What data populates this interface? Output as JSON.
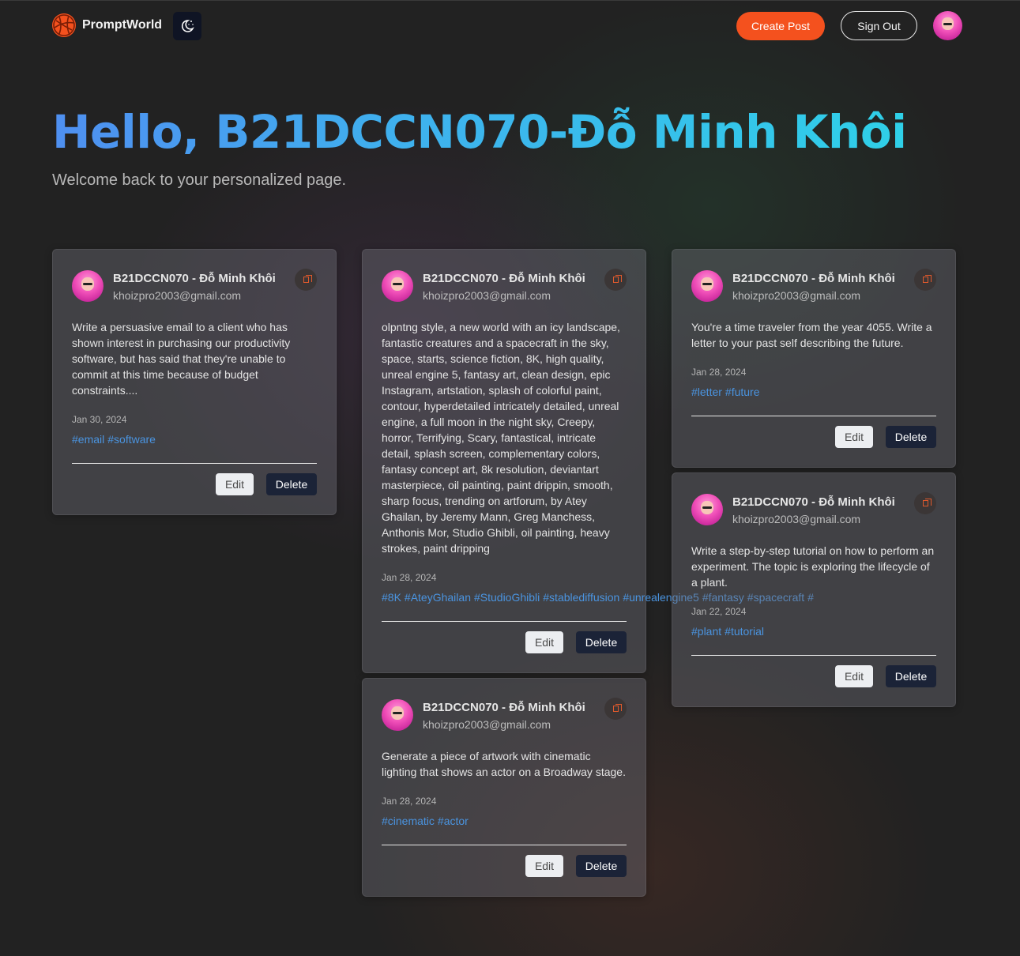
{
  "nav": {
    "brand": "PromptWorld",
    "create_label": "Create Post",
    "signout_label": "Sign Out"
  },
  "hero": {
    "title": "Hello, B21DCCN070-Đỗ Minh Khôi",
    "subtitle": "Welcome back to your personalized page."
  },
  "colors": {
    "accent": "#f4511e",
    "tag": "#4a94e0",
    "delete_button": "#1b2337"
  },
  "cards": [
    {
      "author": "B21DCCN070 - Đỗ Minh Khôi",
      "email": "khoizpro2003@gmail.com",
      "text": "Write a persuasive email to a client who has shown interest in purchasing our productivity software, but has said that they're unable to commit at this time because of budget constraints....",
      "date": "Jan 30, 2024",
      "tags": [
        "#email",
        "#software"
      ],
      "edit": "Edit",
      "delete": "Delete"
    },
    {
      "author": "B21DCCN070 - Đỗ Minh Khôi",
      "email": "khoizpro2003@gmail.com",
      "text": "olpntng style, a new world with an icy landscape, fantastic creatures and a spacecraft in the sky, space, starts, science fiction, 8K, high quality, unreal engine 5, fantasy art, clean design, epic Instagram, artstation, splash of colorful paint, contour, hyperdetailed intricately detailed, unreal engine, a full moon in the night sky, Creepy, horror, Terrifying, Scary, fantastical, intricate detail, splash screen, complementary colors, fantasy concept art, 8k resolution, deviantart masterpiece, oil painting, paint drippin, smooth, sharp focus, trending on artforum, by Atey Ghailan, by Jeremy Mann, Greg Manchess, Anthonis Mor, Studio Ghibli, oil painting, heavy strokes, paint dripping",
      "date": "Jan 28, 2024",
      "tags": [
        "#8K",
        "#AteyGhailan",
        "#StudioGhibli",
        "#stablediffusion",
        "#unrealengine5",
        "#fantasy",
        "#spacecraft",
        "#"
      ],
      "edit": "Edit",
      "delete": "Delete"
    },
    {
      "author": "B21DCCN070 - Đỗ Minh Khôi",
      "email": "khoizpro2003@gmail.com",
      "text": "You're a time traveler from the year 4055. Write a letter to your past self describing the future.",
      "date": "Jan 28, 2024",
      "tags": [
        "#letter",
        "#future"
      ],
      "edit": "Edit",
      "delete": "Delete"
    },
    {
      "author": "B21DCCN070 - Đỗ Minh Khôi",
      "email": "khoizpro2003@gmail.com",
      "text": "Generate a piece of artwork with cinematic lighting that shows an actor on a Broadway stage.",
      "date": "Jan 28, 2024",
      "tags": [
        "#cinematic",
        "#actor"
      ],
      "edit": "Edit",
      "delete": "Delete"
    },
    {
      "author": "B21DCCN070 - Đỗ Minh Khôi",
      "email": "khoizpro2003@gmail.com",
      "text": "Write a step-by-step tutorial on how to perform an experiment. The topic is exploring the lifecycle of a plant.",
      "date": "Jan 22, 2024",
      "tags": [
        "#plant",
        "#tutorial"
      ],
      "edit": "Edit",
      "delete": "Delete"
    }
  ]
}
